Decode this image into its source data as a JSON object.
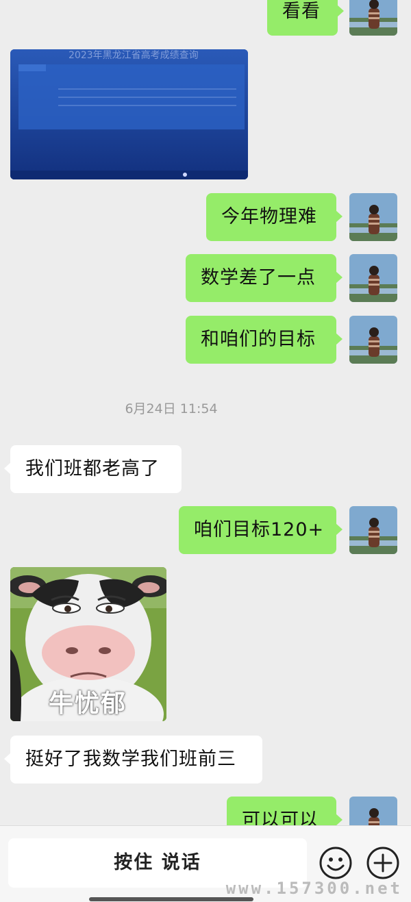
{
  "messages": {
    "m0": "看看",
    "m1": "今年物理难",
    "m2": "数学差了一点",
    "m3": "和咱们的目标",
    "m4": "我们班都老高了",
    "m5": "咱们目标120+",
    "m6": "挺好了我数学我们班前三",
    "m7": "可以可以"
  },
  "timestamp": "6月24日 11:54",
  "screen_photo": {
    "title": "2023年黑龙江省高考成绩查询"
  },
  "sticker": {
    "caption": "牛忧郁"
  },
  "input_bar": {
    "talk_label": "按住 说话"
  },
  "watermark": "www.157300.net",
  "colors": {
    "sent_bubble": "#95ec69",
    "received_bubble": "#ffffff",
    "background": "#ededed"
  },
  "icons": [
    "avatar-icon",
    "emoji-icon",
    "plus-icon"
  ]
}
